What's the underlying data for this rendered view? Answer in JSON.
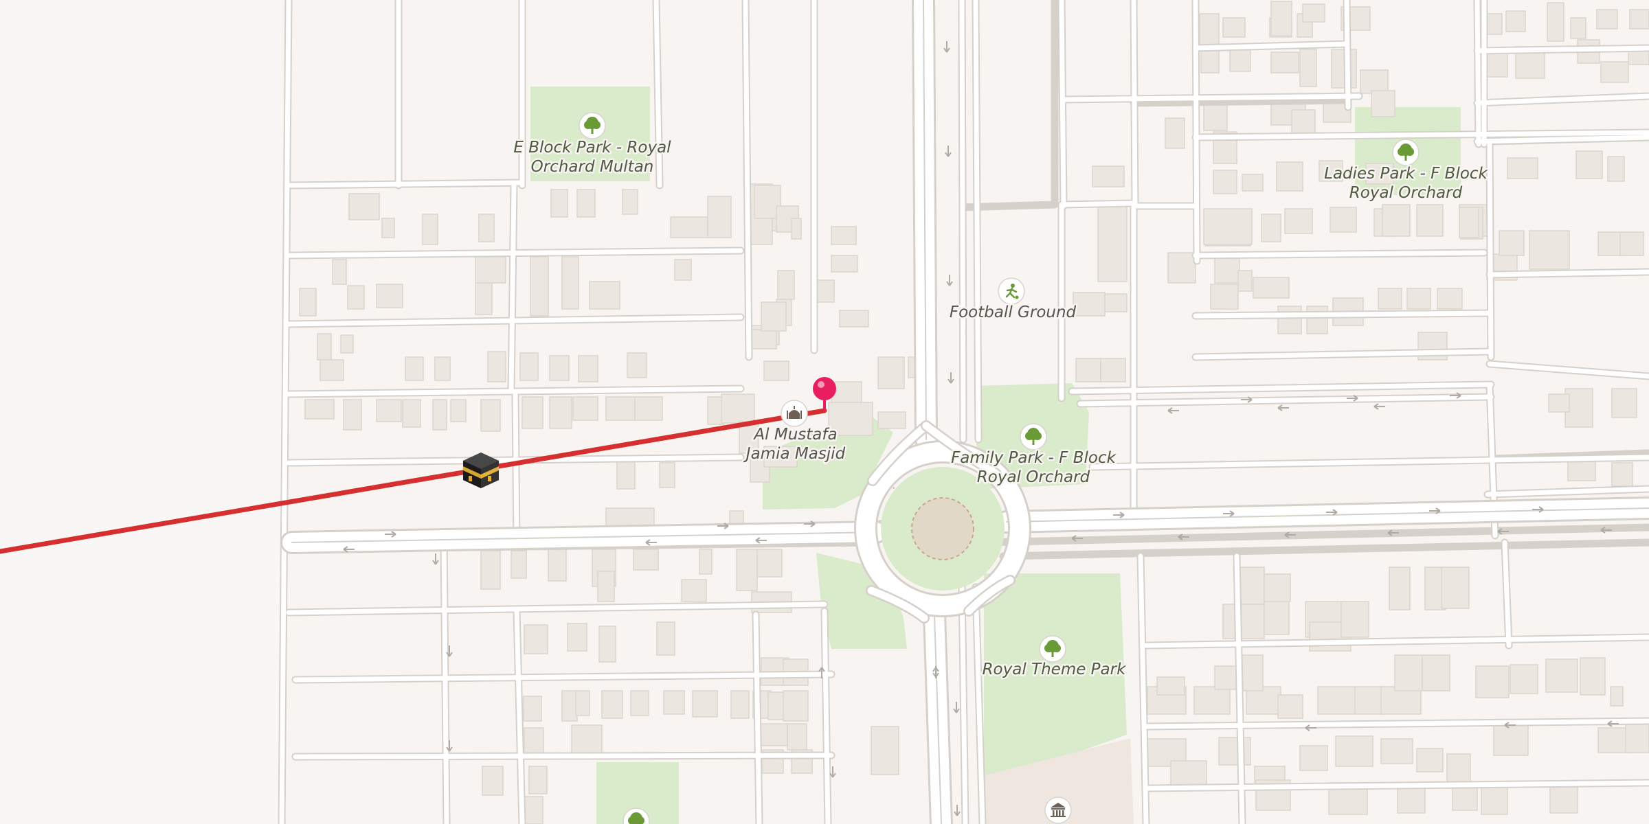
{
  "map": {
    "places": {
      "e_block_park": {
        "line1": "E Block Park - Royal",
        "line2": "Orchard Multan",
        "icon": "tree-icon"
      },
      "ladies_park": {
        "line1": "Ladies Park - F Block",
        "line2": "Royal Orchard",
        "icon": "tree-icon"
      },
      "football_ground": {
        "line1": "Football Ground",
        "icon": "soccer-icon"
      },
      "al_mustafa_masjid": {
        "line1": "Al Mustafa",
        "line2": "Jamia Masjid",
        "icon": "mosque-icon"
      },
      "family_park": {
        "line1": "Family Park - F Block",
        "line2": "Royal Orchard",
        "icon": "tree-icon"
      },
      "royal_theme_park": {
        "line1": "Royal Theme Park",
        "icon": "tree-icon"
      }
    },
    "markers": {
      "location_pin": {
        "icon": "map-pin-icon",
        "color": "#e91e5e"
      },
      "kaaba": {
        "icon": "kaaba-icon"
      },
      "museum": {
        "icon": "museum-icon"
      },
      "unnamed_park": {
        "icon": "tree-icon"
      }
    },
    "qibla_line": {
      "color": "#d62f2f"
    },
    "colors": {
      "background": "#f7f4f1",
      "park": "#d9ebcb",
      "road": "#ffffff",
      "road_edge": "#d6d0ca",
      "building": "#ece6e1",
      "park_icon": "#6a9a35"
    }
  }
}
